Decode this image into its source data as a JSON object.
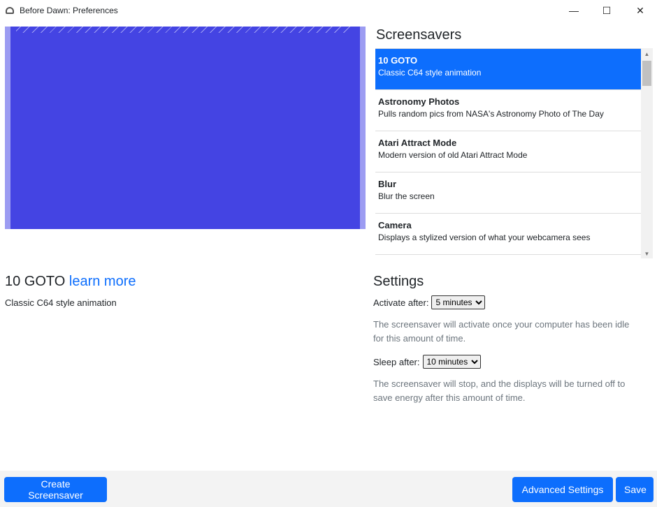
{
  "window": {
    "title": "Before Dawn: Preferences",
    "minimize": "—",
    "maximize": "☐",
    "close": "✕"
  },
  "screensavers": {
    "title": "Screensavers",
    "items": [
      {
        "name": "10 GOTO",
        "description": "Classic C64 style animation",
        "selected": true
      },
      {
        "name": "Astronomy Photos",
        "description": "Pulls random pics from NASA's Astronomy Photo of The Day"
      },
      {
        "name": "Atari Attract Mode",
        "description": "Modern version of old Atari Attract Mode"
      },
      {
        "name": "Blur",
        "description": "Blur the screen"
      },
      {
        "name": "Camera",
        "description": "Displays a stylized version of what your webcamera sees"
      }
    ]
  },
  "current": {
    "name": "10 GOTO",
    "learn_more": "learn more",
    "description": "Classic C64 style animation"
  },
  "settings": {
    "title": "Settings",
    "activate_label": "Activate after:",
    "activate_value": "5 minutes",
    "activate_help": "The screensaver will activate once your computer has been idle for this amount of time.",
    "sleep_label": "Sleep after:",
    "sleep_value": "10 minutes",
    "sleep_help": "The screensaver will stop, and the displays will be turned off to save energy after this amount of time."
  },
  "buttons": {
    "create": "Create Screensaver",
    "advanced": "Advanced Settings",
    "save": "Save"
  },
  "colors": {
    "accent": "#0d6efd",
    "preview": "#4444e3"
  }
}
